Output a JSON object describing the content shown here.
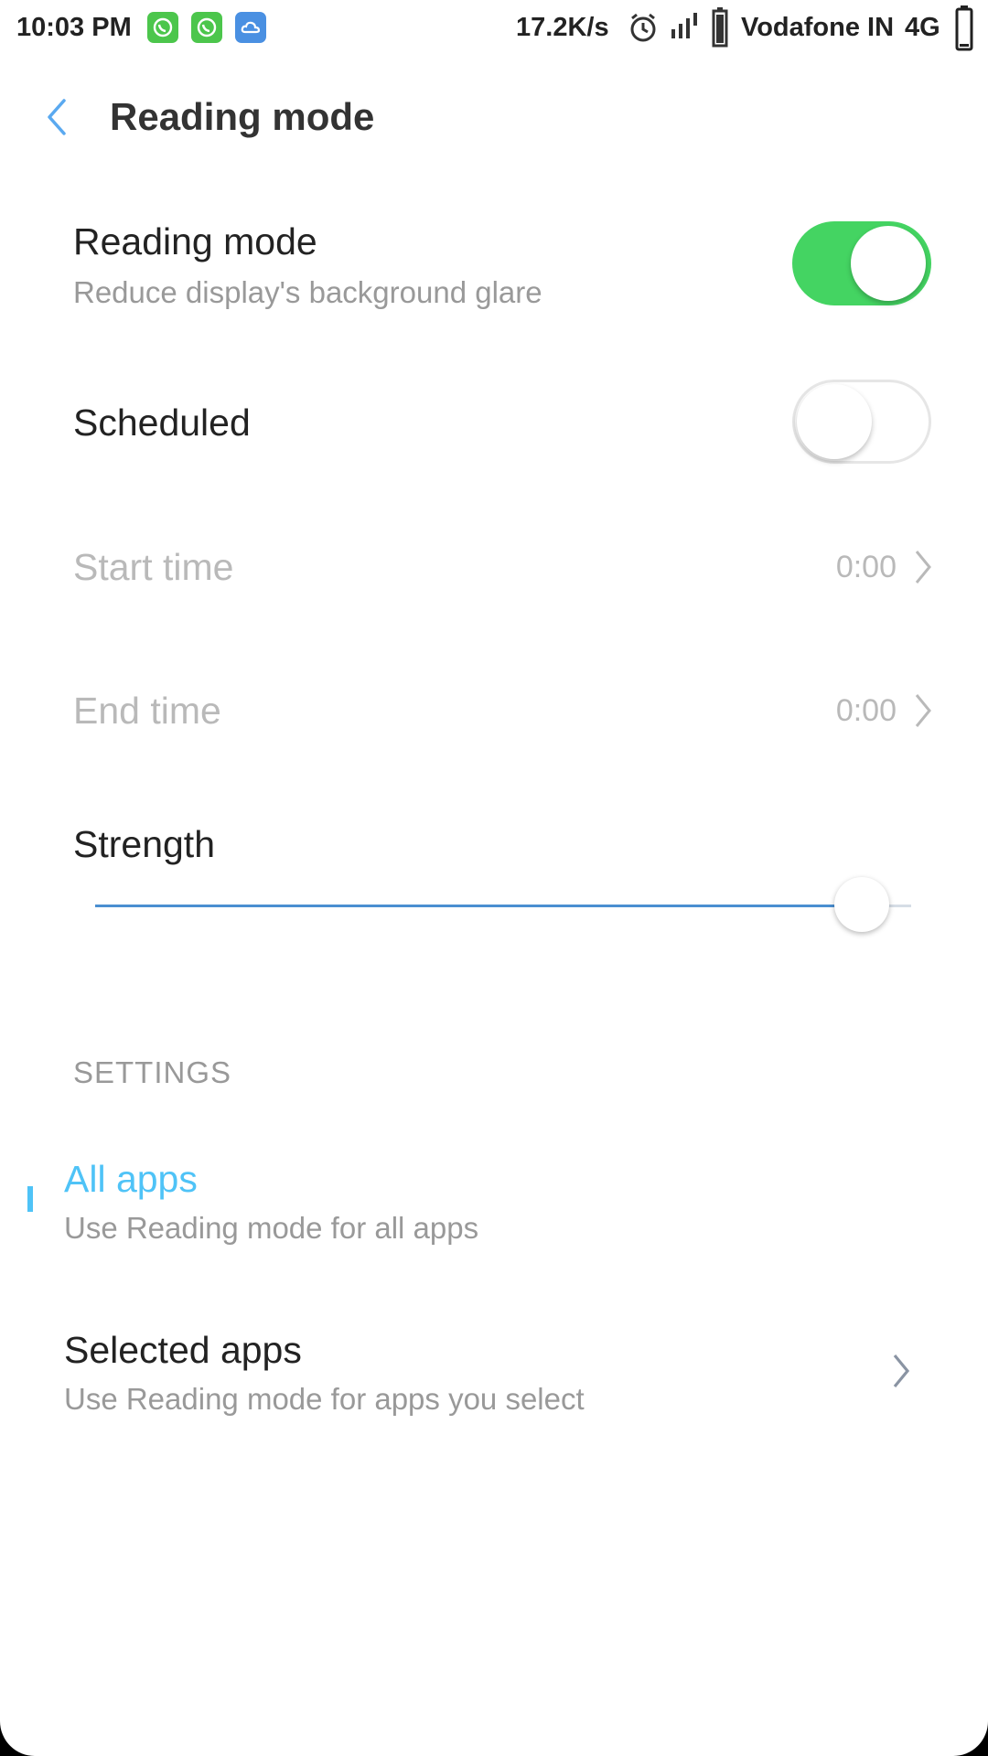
{
  "status_bar": {
    "time": "10:03 PM",
    "notifications": [
      {
        "icon": "whatsapp-icon",
        "color": "#4cc64c"
      },
      {
        "icon": "whatsapp-icon",
        "color": "#4cc64c"
      },
      {
        "icon": "cloud-icon",
        "color": "#4a90e2"
      }
    ],
    "network_speed": "17.2K/s",
    "carrier": "Vodafone IN",
    "network_type": "4G"
  },
  "app_bar": {
    "back_icon": "chevron-left-icon",
    "title": "Reading mode"
  },
  "reading_mode": {
    "title": "Reading mode",
    "subtitle": "Reduce display's background glare",
    "enabled": true
  },
  "scheduled": {
    "title": "Scheduled",
    "enabled": false
  },
  "start_time": {
    "title": "Start time",
    "value": "0:00"
  },
  "end_time": {
    "title": "End time",
    "value": "0:00"
  },
  "strength": {
    "title": "Strength",
    "level_percent": 94
  },
  "settings_section": {
    "header": "SETTINGS",
    "options": [
      {
        "title": "All apps",
        "subtitle": "Use Reading mode for all apps",
        "selected": true
      },
      {
        "title": "Selected apps",
        "subtitle": "Use Reading mode for apps you select",
        "selected": false
      }
    ]
  },
  "colors": {
    "switch_on": "#44d462",
    "accent_blue": "#4fc3f7",
    "back_blue": "#5aa9f0"
  }
}
